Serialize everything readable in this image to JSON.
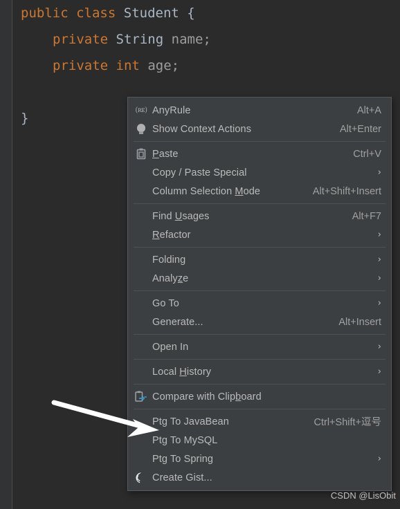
{
  "editor": {
    "lines": [
      {
        "indent": 0,
        "tokens": [
          {
            "t": "public",
            "c": "kw"
          },
          {
            "t": " ",
            "c": "punct"
          },
          {
            "t": "class",
            "c": "kw"
          },
          {
            "t": " ",
            "c": "punct"
          },
          {
            "t": "Student",
            "c": "cls"
          },
          {
            "t": " {",
            "c": "punct"
          }
        ]
      },
      {
        "indent": 1,
        "tokens": [
          {
            "t": "private",
            "c": "kw"
          },
          {
            "t": " ",
            "c": "punct"
          },
          {
            "t": "String",
            "c": "cls"
          },
          {
            "t": " ",
            "c": "punct"
          },
          {
            "t": "name;",
            "c": "fld"
          }
        ]
      },
      {
        "indent": 1,
        "tokens": [
          {
            "t": "private",
            "c": "kw"
          },
          {
            "t": " ",
            "c": "punct"
          },
          {
            "t": "int",
            "c": "kw"
          },
          {
            "t": " ",
            "c": "punct"
          },
          {
            "t": "age;",
            "c": "fld"
          }
        ]
      },
      {
        "indent": 0,
        "tokens": []
      },
      {
        "indent": 0,
        "tokens": [
          {
            "t": "}",
            "c": "punct"
          }
        ]
      }
    ],
    "plain_text": "public class Student {\n    private String name;\n    private int age;\n\n}"
  },
  "context_menu": {
    "groups": [
      {
        "items": [
          {
            "icon": "anyrule-icon",
            "icon_text": "(ʀᴇ)",
            "label": "AnyRule",
            "shortcut": "Alt+A",
            "submenu": false
          },
          {
            "icon": "lightbulb-icon",
            "label": "Show Context Actions",
            "shortcut": "Alt+Enter",
            "submenu": false
          }
        ]
      },
      {
        "items": [
          {
            "icon": "paste-icon",
            "label": "Paste",
            "mnemonic": "P",
            "shortcut": "Ctrl+V",
            "submenu": false
          },
          {
            "icon": "",
            "label": "Copy / Paste Special",
            "shortcut": "",
            "submenu": true
          },
          {
            "icon": "",
            "label": "Column Selection Mode",
            "mnemonic": "M",
            "shortcut": "Alt+Shift+Insert",
            "submenu": false
          }
        ]
      },
      {
        "items": [
          {
            "icon": "",
            "label": "Find Usages",
            "mnemonic": "U",
            "shortcut": "Alt+F7",
            "submenu": false
          },
          {
            "icon": "",
            "label": "Refactor",
            "mnemonic": "R",
            "shortcut": "",
            "submenu": true
          }
        ]
      },
      {
        "items": [
          {
            "icon": "",
            "label": "Folding",
            "shortcut": "",
            "submenu": true
          },
          {
            "icon": "",
            "label": "Analyze",
            "mnemonic": "z",
            "shortcut": "",
            "submenu": true
          }
        ]
      },
      {
        "items": [
          {
            "icon": "",
            "label": "Go To",
            "shortcut": "",
            "submenu": true
          },
          {
            "icon": "",
            "label": "Generate...",
            "shortcut": "Alt+Insert",
            "submenu": false
          }
        ]
      },
      {
        "items": [
          {
            "icon": "",
            "label": "Open In",
            "shortcut": "",
            "submenu": true
          }
        ]
      },
      {
        "items": [
          {
            "icon": "",
            "label": "Local History",
            "mnemonic": "H",
            "shortcut": "",
            "submenu": true
          }
        ]
      },
      {
        "items": [
          {
            "icon": "compare-clipboard-icon",
            "label": "Compare with Clipboard",
            "mnemonic": "b",
            "shortcut": "",
            "submenu": false
          }
        ]
      },
      {
        "items": [
          {
            "icon": "",
            "label": "Ptg To JavaBean",
            "shortcut": "Ctrl+Shift+逗号",
            "submenu": false
          },
          {
            "icon": "",
            "label": "Ptg To MySQL",
            "shortcut": "",
            "submenu": false
          },
          {
            "icon": "",
            "label": "Ptg To Spring",
            "shortcut": "",
            "submenu": true
          },
          {
            "icon": "github-icon",
            "label": "Create Gist...",
            "shortcut": "",
            "submenu": false
          }
        ]
      }
    ]
  },
  "annotation": {
    "arrow_target_label": "Ptg To JavaBean"
  },
  "watermark": {
    "text": "CSDN @LisObit"
  },
  "colors": {
    "editor_background": "#2b2b2b",
    "gutter_background": "#313335",
    "caret_line": "#323232",
    "menu_background": "#3c3f41",
    "menu_border": "#565a5c",
    "menu_text": "#bbbbbb",
    "shortcut_text": "#a0a0a0",
    "keyword": "#cc7832",
    "class_name": "#a9b7c6",
    "field_name": "#9e9e9e",
    "accent_blue": "#3592c4",
    "arrow_color": "#ffffff"
  }
}
